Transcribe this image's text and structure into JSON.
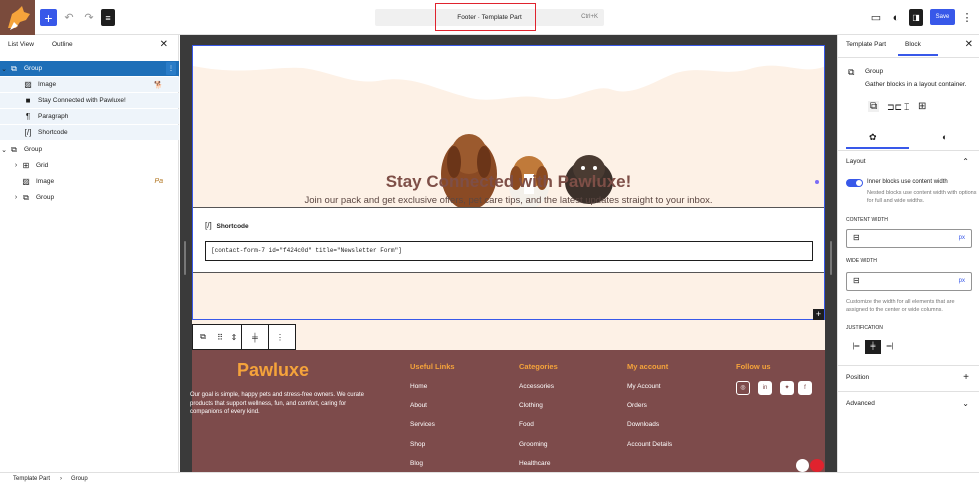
{
  "topbar": {
    "add_icon": "plus-icon",
    "undo_icon": "undo-icon",
    "redo_icon": "redo-icon",
    "tools_icon": "list-view-icon",
    "document_title": "Footer · Template Part",
    "shortcut": "Ctrl+K",
    "save_label": "Save",
    "accent": "#3858e9",
    "highlight_color": "#e0232e"
  },
  "left_panel": {
    "tabs": [
      "List View",
      "Outline"
    ],
    "tree": [
      {
        "label": "Group",
        "icon": "group-icon",
        "selected": true
      },
      {
        "label": "Image",
        "icon": "image-icon"
      },
      {
        "label": "Stay Connected with Pawluxe!",
        "icon": "heading-icon"
      },
      {
        "label": "Paragraph",
        "icon": "paragraph-icon"
      },
      {
        "label": "Shortcode",
        "icon": "shortcode-icon"
      },
      {
        "label": "Group",
        "icon": "group-icon"
      },
      {
        "label": "Grid",
        "icon": "grid-icon"
      },
      {
        "label": "Image",
        "icon": "image-icon"
      },
      {
        "label": "Group",
        "icon": "group-icon"
      }
    ]
  },
  "hero": {
    "title": "Stay Connected with Pawluxe!",
    "subtitle": "Join our pack and get exclusive offers, pet care tips, and the latest updates straight to your inbox.",
    "shortcode_label": "Shortcode",
    "shortcode_value": "[contact-form-7 id=\"f424c0d\" title=\"Newsletter Form\"]"
  },
  "footer": {
    "brand": "Pawluxe",
    "description": "Our goal is simple, happy pets and stress-free owners. We curate products that support wellness, fun, and comfort, caring for companions of every kind.",
    "columns": [
      {
        "title": "Useful Links",
        "links": [
          "Home",
          "About",
          "Services",
          "Shop",
          "Blog"
        ]
      },
      {
        "title": "Categories",
        "links": [
          "Accessories",
          "Clothing",
          "Food",
          "Grooming",
          "Healthcare"
        ]
      },
      {
        "title": "My account",
        "links": [
          "My Account",
          "Orders",
          "Downloads",
          "Account Details"
        ]
      },
      {
        "title": "Follow us",
        "links": []
      }
    ],
    "social_icons": [
      "instagram-icon",
      "linkedin-icon",
      "twitter-icon",
      "facebook-icon"
    ],
    "brand_color": "#f5a33b",
    "bg_color": "#7d4b4b"
  },
  "right_panel": {
    "tabs": [
      "Template Part",
      "Block"
    ],
    "block_name": "Group",
    "block_desc": "Gather blocks in a layout container.",
    "layout_label": "Layout",
    "toggle_label": "Inner blocks use content width",
    "toggle_help": "Nested blocks use content width with options for full and wide widths.",
    "content_width_label": "CONTENT WIDTH",
    "wide_width_label": "WIDE WIDTH",
    "unit": "px",
    "width_help": "Customize the width for all elements that are assigned to the center or wide columns.",
    "justification_label": "JUSTIFICATION",
    "position_label": "Position",
    "advanced_label": "Advanced"
  },
  "statusbar": {
    "crumb1": "Template Part",
    "separator": "›",
    "crumb2": "Group"
  }
}
